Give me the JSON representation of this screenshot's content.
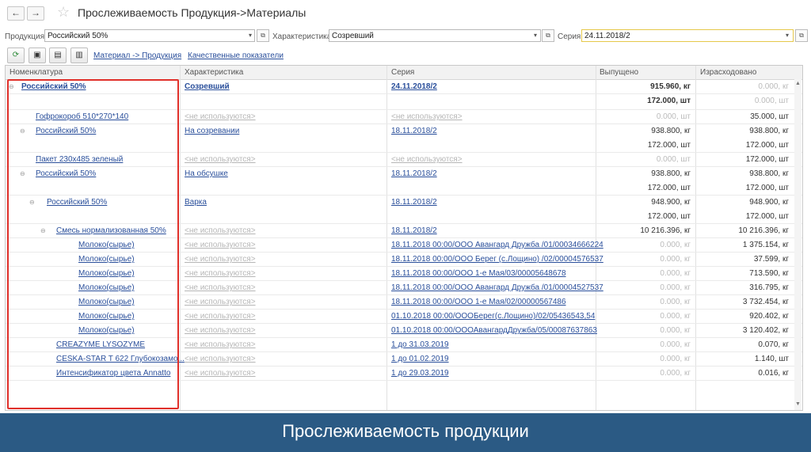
{
  "window": {
    "title": "Прослеживаемость Продукция->Материалы",
    "back_icon": "←",
    "forward_icon": "→",
    "star_icon": "☆"
  },
  "filters": {
    "product_label": "Продукция:",
    "product_value": "Российский 50%",
    "characteristic_label": "Характеристика:",
    "characteristic_value": "Созревший",
    "series_label": "Серия:",
    "series_value": "24.11.2018/2",
    "dropdown_icon": "▾",
    "open_icon": "⧉"
  },
  "toolbar": {
    "refresh_icon": "⟳",
    "btn2_icon": "▣",
    "btn3_icon": "▤",
    "btn4_icon": "▥",
    "link_material": "Материал -> Продукция",
    "link_quality": "Качественные показатели"
  },
  "table": {
    "headers": {
      "nomenclature": "Номенклатура",
      "characteristic": "Характеристика",
      "series": "Серия",
      "released": "Выпущено",
      "consumed": "Израсходовано"
    },
    "rows": [
      {
        "name": "Российский 50%",
        "characteristic": "Созревший",
        "series": "24.11.2018/2",
        "released": "915.960, кг",
        "consumed": "0.000, кг"
      },
      {
        "name": "",
        "characteristic": "",
        "series": "",
        "released": "172.000, шт",
        "consumed": "0.000, шт"
      },
      {
        "name": "Гофрокороб 510*270*140",
        "characteristic": "<не используются>",
        "series": "<не используются>",
        "released": "0.000, шт",
        "consumed": "35.000, шт"
      },
      {
        "name": "Российский 50%",
        "characteristic": "На созревании",
        "series": "18.11.2018/2",
        "released": "938.800, кг",
        "consumed": "938.800, кг"
      },
      {
        "name": "",
        "characteristic": "",
        "series": "",
        "released": "172.000, шт",
        "consumed": "172.000, шт"
      },
      {
        "name": "Пакет 230х485 зеленый",
        "characteristic": "<не используются>",
        "series": "<не используются>",
        "released": "0.000, шт",
        "consumed": "172.000, шт"
      },
      {
        "name": "Российский 50%",
        "characteristic": "На обсушке",
        "series": "18.11.2018/2",
        "released": "938.800, кг",
        "consumed": "938.800, кг"
      },
      {
        "name": "",
        "characteristic": "",
        "series": "",
        "released": "172.000, шт",
        "consumed": "172.000, шт"
      },
      {
        "name": "Российский 50%",
        "characteristic": "Варка",
        "series": "18.11.2018/2",
        "released": "948.900, кг",
        "consumed": "948.900, кг"
      },
      {
        "name": "",
        "characteristic": "",
        "series": "",
        "released": "172.000, шт",
        "consumed": "172.000, шт"
      },
      {
        "name": "Смесь нормализованная 50%",
        "characteristic": "<не используются>",
        "series": "18.11.2018/2",
        "released": "10 216.396, кг",
        "consumed": "10 216.396, кг"
      },
      {
        "name": "Молоко(сырье)",
        "characteristic": "<не используются>",
        "series": "18.11.2018 00:00/ООО Авангард Дружба /01/00034666224",
        "released": "0.000, кг",
        "consumed": "1 375.154, кг"
      },
      {
        "name": "Молоко(сырье)",
        "characteristic": "<не используются>",
        "series": "18.11.2018 00:00/ООО Берег (с.Лощино) /02/00004576537",
        "released": "0.000, кг",
        "consumed": "37.599, кг"
      },
      {
        "name": "Молоко(сырье)",
        "characteristic": "<не используются>",
        "series": "18.11.2018 00:00/ООО 1-е Мая/03/00005648678",
        "released": "0.000, кг",
        "consumed": "713.590, кг"
      },
      {
        "name": "Молоко(сырье)",
        "characteristic": "<не используются>",
        "series": "18.11.2018 00:00/ООО Авангард Дружба /01/00004527537",
        "released": "0.000, кг",
        "consumed": "316.795, кг"
      },
      {
        "name": "Молоко(сырье)",
        "characteristic": "<не используются>",
        "series": "18.11.2018 00:00/ООО 1-е Мая/02/00000567486",
        "released": "0.000, кг",
        "consumed": "3 732.454, кг"
      },
      {
        "name": "Молоко(сырье)",
        "characteristic": "<не используются>",
        "series": "01.10.2018 00:00/ОООБерег(с.Лощино)/02/05436543,54",
        "released": "0.000, кг",
        "consumed": "920.402, кг"
      },
      {
        "name": "Молоко(сырье)",
        "characteristic": "<не используются>",
        "series": "01.10.2018 00:00/ОООАвангардДружба/05/00087637863",
        "released": "0.000, кг",
        "consumed": "3 120.402, кг"
      },
      {
        "name": "CREAZYME LYSOZYME",
        "characteristic": "<не используются>",
        "series": "1 до 31.03.2019",
        "released": "0.000, кг",
        "consumed": "0.070, кг"
      },
      {
        "name": "CESKA-STAR T 622 Глубокозамо...",
        "characteristic": "<не используются>",
        "series": "1 до 01.02.2019",
        "released": "0.000, кг",
        "consumed": "1.140, шт"
      },
      {
        "name": "Интенсификатор цвета Annatto",
        "characteristic": "<не используются>",
        "series": "1 до 29.03.2019",
        "released": "0.000, кг",
        "consumed": "0.016, кг"
      }
    ],
    "collapse_icon": "⊖"
  },
  "footer": {
    "caption": "Прослеживаемость продукции"
  },
  "colors": {
    "link": "#2a4f9b",
    "highlight": "#e0302a",
    "footer_bg": "#2b5a84"
  }
}
